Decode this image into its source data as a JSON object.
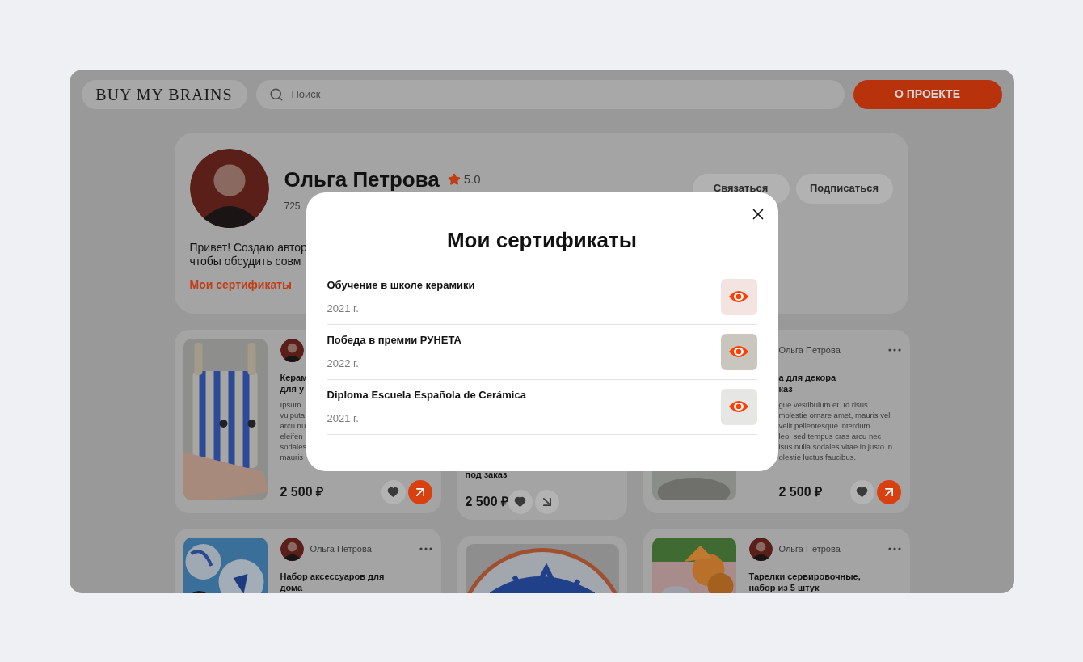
{
  "header": {
    "logo": "BUY MY BRAINS",
    "search": {
      "placeholder": "Поиск"
    },
    "about_button": "О ПРОЕКТЕ"
  },
  "profile": {
    "name": "Ольга Петрова",
    "rating": "5.0",
    "subtitle": "725",
    "actions": [
      "Связаться",
      "Подписаться"
    ],
    "bio_lines": [
      "Привет! Создаю автор",
      "чтобы обсудить совм"
    ],
    "certificates_link": "Мои сертификаты"
  },
  "product_rows": [
    [
      {
        "kind": "side",
        "avatar": true,
        "menu": false,
        "title_lines": [
          "Керам",
          "для у"
        ],
        "description_lines": [
          "Ipsum",
          "vulputa",
          "arcu nu",
          "eleifen",
          "sodales",
          "mauris"
        ],
        "price": "2 500 ₽",
        "active": true
      },
      {
        "kind": "bottom",
        "title_lines": [
          "под заказ"
        ],
        "price": "2 500 ₽",
        "active": false
      },
      {
        "kind": "side",
        "avatar": false,
        "author": "Ольга Петрова",
        "menu": true,
        "title_lines": [
          "а для декора",
          "каз"
        ],
        "description_lines": [
          "gue vestibulum et. Id risus",
          "molestie ornare amet, mauris vel",
          "velit pellentesque interdum",
          "leo, sed tempus cras arcu nec",
          "isus nulla sodales vitae in justo in",
          "olestie luctus faucibus."
        ],
        "price": "2 500 ₽",
        "active": true
      }
    ],
    [
      {
        "kind": "side",
        "avatar": true,
        "author": "Ольга Петрова",
        "menu": true,
        "title_lines": [
          "Набор аксессуаров для",
          "дома"
        ]
      },
      {
        "kind": "top"
      },
      {
        "kind": "side",
        "avatar": true,
        "author": "Ольга Петрова",
        "menu": true,
        "title_lines": [
          "Тарелки сервировочные,",
          "набор из 5 штук"
        ]
      }
    ]
  ],
  "modal": {
    "title": "Мои сертификаты",
    "certificates": [
      {
        "title": "Обучение в школе керамики",
        "year": "2021 г."
      },
      {
        "title": "Победа в премии РУНЕТА",
        "year": "2022 г."
      },
      {
        "title": "Diploma Escuela Española de Cerámica",
        "year": "2021 г."
      }
    ]
  }
}
